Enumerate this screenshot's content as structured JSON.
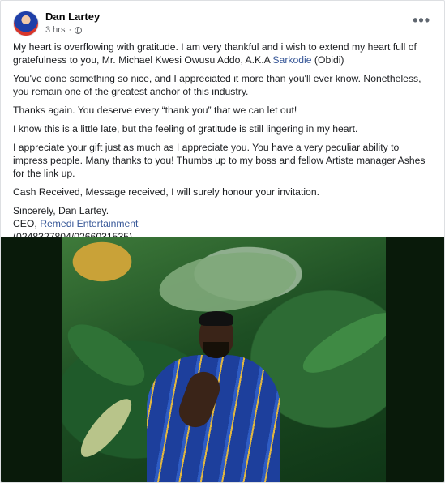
{
  "post": {
    "author": "Dan Lartey",
    "time": "3 hrs",
    "more_label": "•••",
    "paragraphs": {
      "p1_text": "My heart is overflowing with gratitude.  I am very thankful and i wish to extend my heart full of gratefulness to you, Mr. Michael Kwesi Owusu Addo, A.K.A ",
      "p1_link": "Sarkodie",
      "p1_tail": " (Obidi)",
      "p2": "You've done something so nice, and I appreciated it more than you'll ever know. Nonetheless, you remain one of the greatest anchor of this industry.",
      "p3": "Thanks again. You deserve every “thank you” that we can let out!",
      "p4": "I know this is a little late, but the feeling of gratitude is still lingering in my heart.",
      "p5": "I appreciate your gift just as much as I appreciate you. You have a very peculiar ability to impress people. Many thanks to you! Thumbs up to my boss and fellow Artiste manager Ashes for the link up.",
      "p6": "Cash Received, Message received, I will surely honour your invitation.",
      "sign_1": "Sincerely, Dan Lartey.",
      "sign_2_prefix": "CEO, ",
      "sign_2_link": "Remedi Entertainment",
      "sign_3": "(0248327804/0266031535)"
    }
  },
  "icons": {
    "privacy": "globe-icon",
    "menu": "more-options-icon"
  }
}
